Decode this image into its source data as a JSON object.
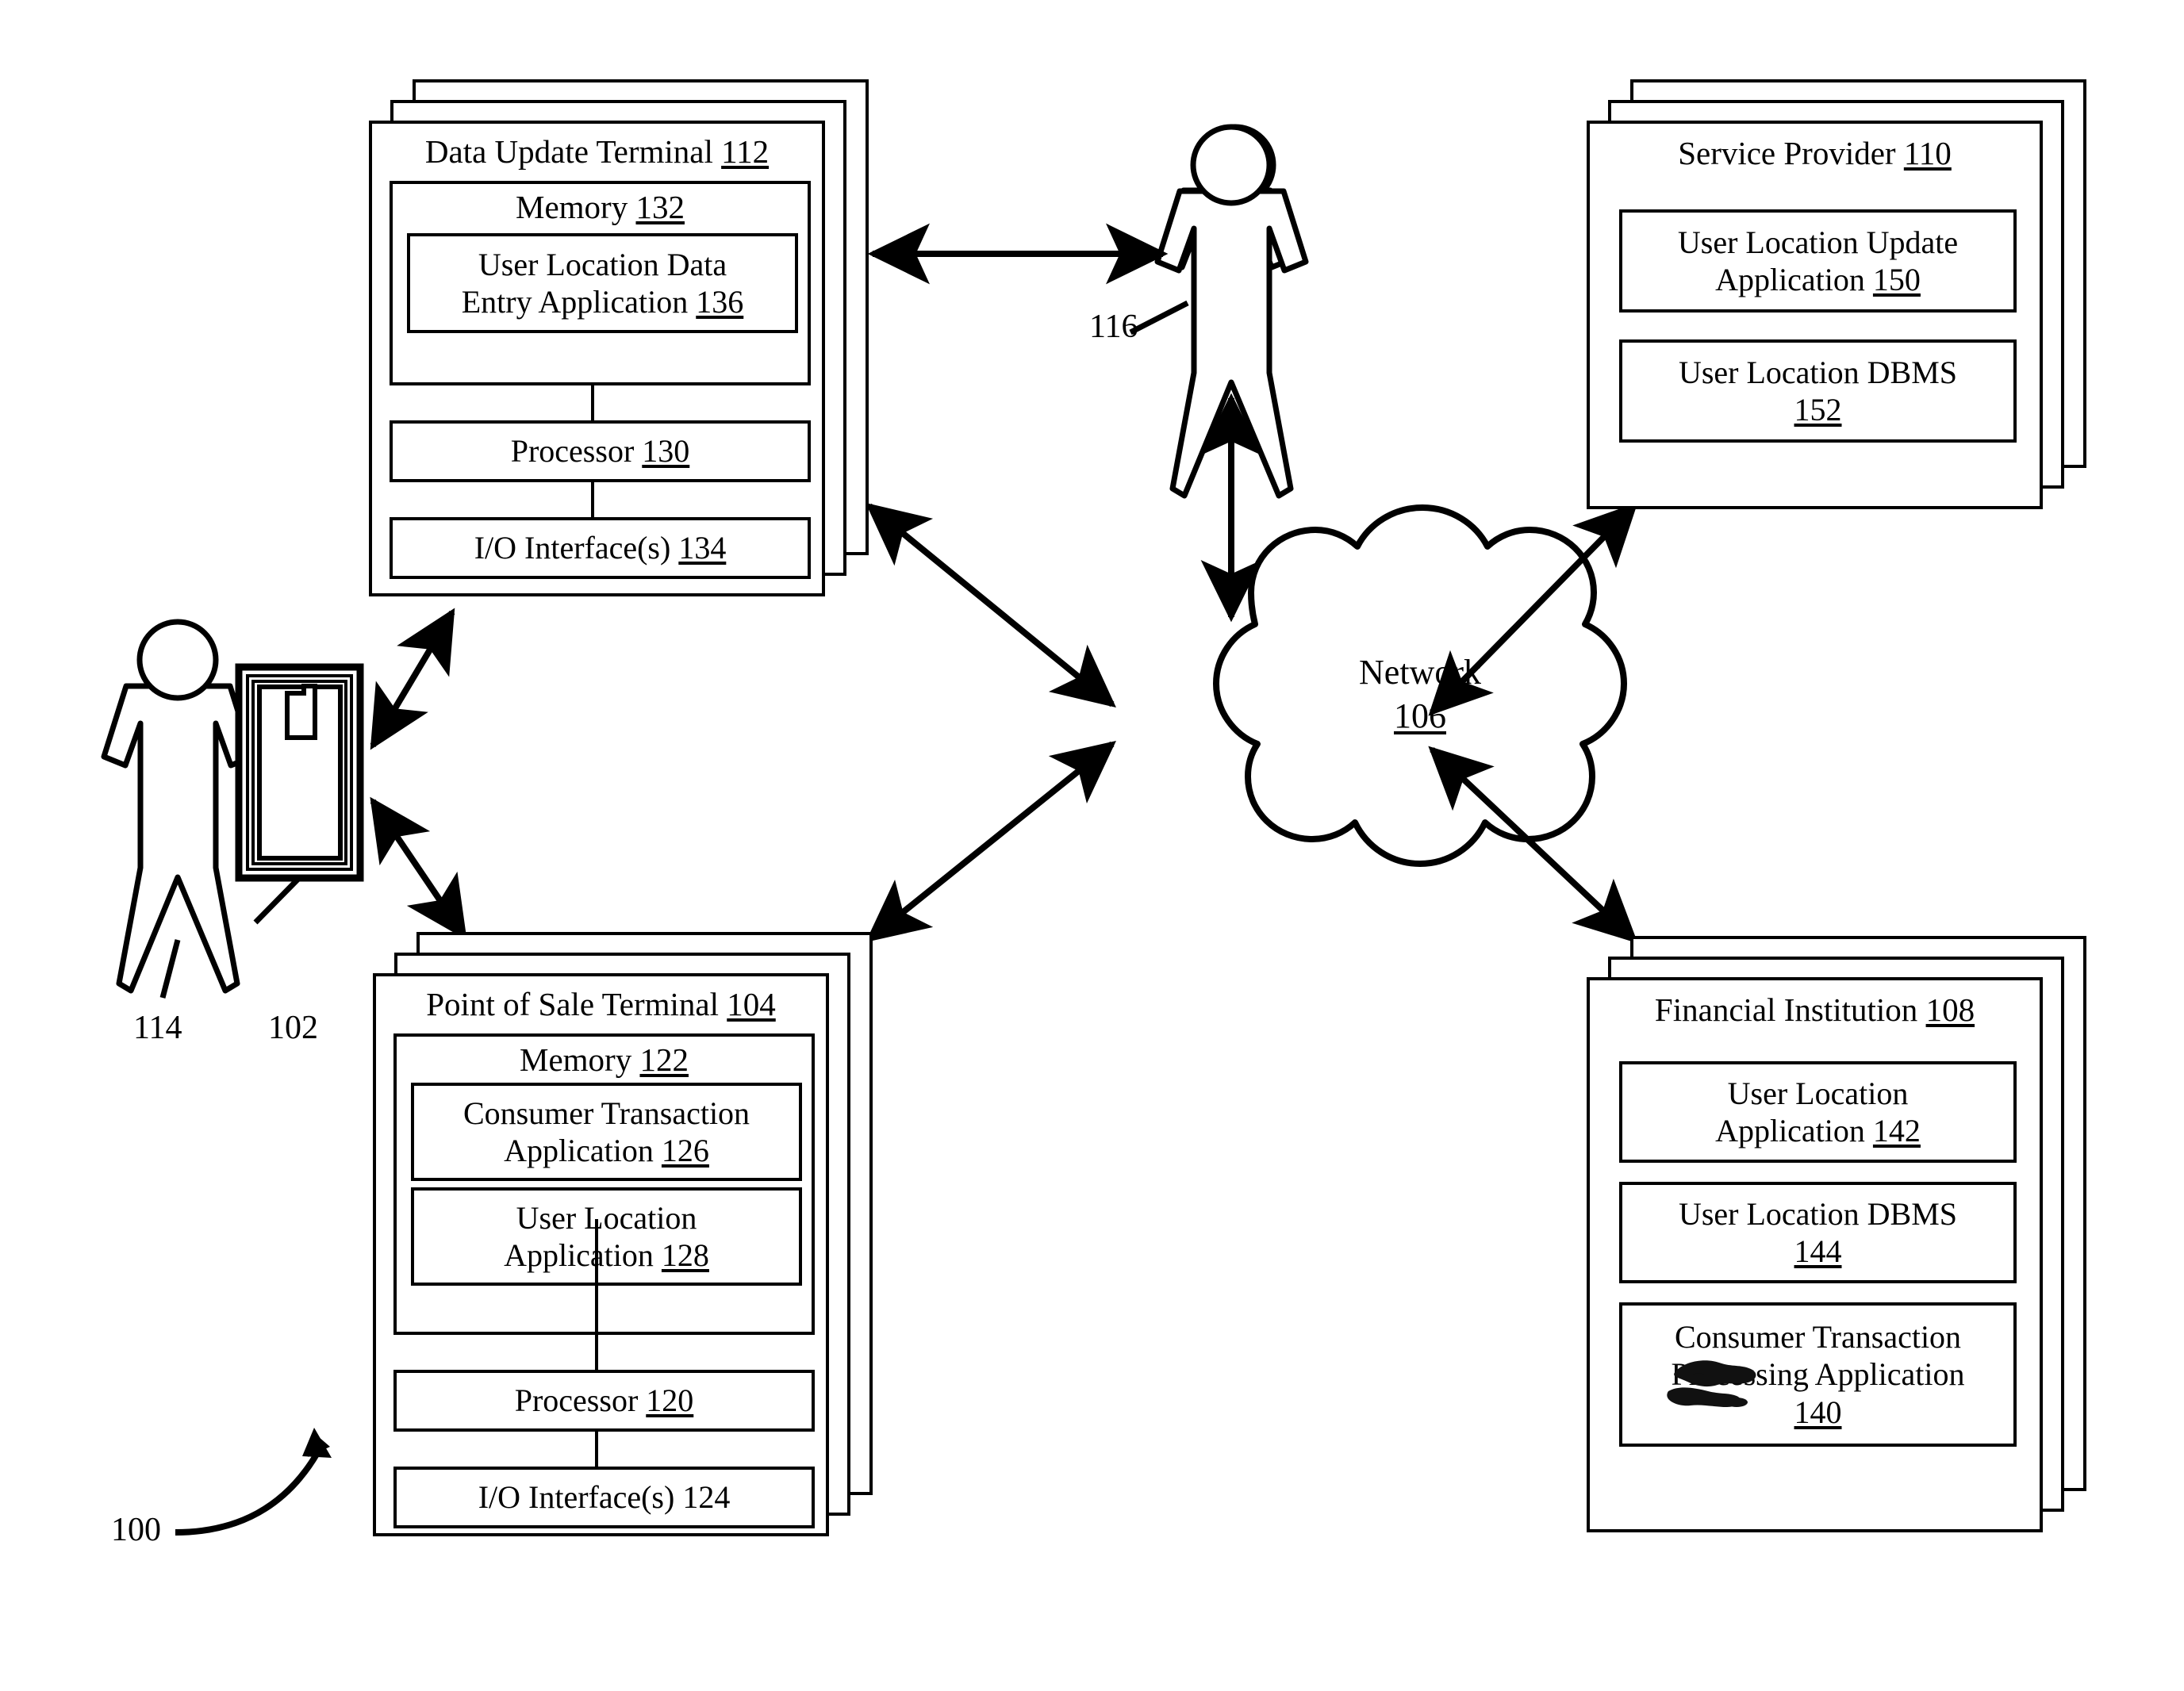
{
  "figure": {
    "figure_ref": "100",
    "nodes": {
      "data_update_terminal": {
        "title_text": "Data Update Terminal",
        "title_ref": "112",
        "memory_text": "Memory",
        "memory_ref": "132",
        "app1_line1": "User Location Data",
        "app1_line2": "Entry Application",
        "app1_ref": "136",
        "processor_text": "Processor",
        "processor_ref": "130",
        "io_text": "I/O Interface(s)",
        "io_ref": "134"
      },
      "point_of_sale_terminal": {
        "title_text": "Point of Sale Terminal",
        "title_ref": "104",
        "memory_text": "Memory",
        "memory_ref": "122",
        "app1_line1": "Consumer Transaction",
        "app1_line2": "Application",
        "app1_ref": "126",
        "app2_line1": "User Location",
        "app2_line2": "Application",
        "app2_ref": "128",
        "processor_text": "Processor",
        "processor_ref": "120",
        "io_text": "I/O Interface(s)",
        "io_ref": "124"
      },
      "service_provider": {
        "title_text": "Service Provider",
        "title_ref": "110",
        "app1_line1": "User Location Update",
        "app1_line2": "Application",
        "app1_ref": "150",
        "app2_line1": "User Location DBMS",
        "app2_ref": "152"
      },
      "financial_institution": {
        "title_text": "Financial Institution",
        "title_ref": "108",
        "app1_line1": "User Location",
        "app1_line2": "Application",
        "app1_ref": "142",
        "app2_line1": "User Location DBMS",
        "app2_ref": "144",
        "app3_line1": "Consumer Transaction",
        "app3_line2": "Processing Application",
        "app3_ref": "140"
      },
      "network": {
        "label_text": "Network",
        "label_ref": "106"
      },
      "mobile_device": {
        "label_ref": "102"
      },
      "user_person": {
        "label_ref": "114"
      },
      "operator_person": {
        "label_ref": "116"
      }
    },
    "colors": {
      "ink": "#000000",
      "paper": "#ffffff"
    }
  }
}
